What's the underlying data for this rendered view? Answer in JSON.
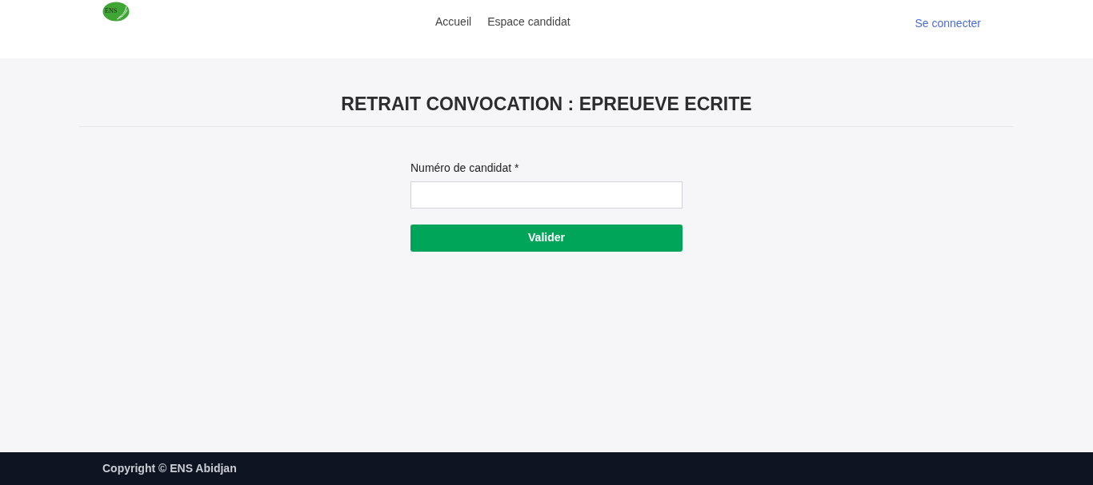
{
  "logo": {
    "text": "ENS"
  },
  "nav": [
    {
      "label": "Accueil"
    },
    {
      "label": "Espace candidat"
    }
  ],
  "login": "Se connecter",
  "title": "RETRAIT CONVOCATION : EPREUEVE ECRITE",
  "form": {
    "label": "Numéro de candidat *",
    "button": "Valider"
  },
  "footer": "Copyright © ENS Abidjan"
}
